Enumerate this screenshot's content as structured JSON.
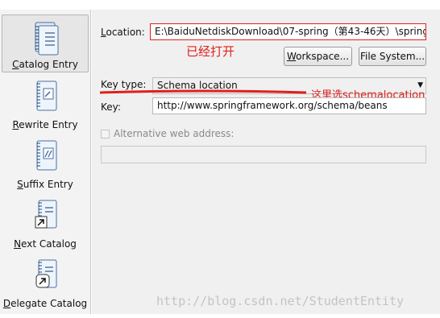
{
  "sidebar": {
    "items": [
      {
        "label": "Catalog Entry",
        "selected": true,
        "icon": "catalog-entry-icon"
      },
      {
        "label": "Rewrite Entry",
        "selected": false,
        "icon": "rewrite-entry-icon"
      },
      {
        "label": "Suffix Entry",
        "selected": false,
        "icon": "suffix-entry-icon"
      },
      {
        "label": "Next Catalog",
        "selected": false,
        "icon": "next-catalog-icon"
      },
      {
        "label": "Delegate Catalog",
        "selected": false,
        "icon": "delegate-catalog-icon"
      }
    ]
  },
  "form": {
    "location_label": "Location:",
    "location_value": "E:\\BaiduNetdiskDownload\\07-spring（第43-46天）\\spring",
    "location_note": "已经打开",
    "workspace_button": "Workspace...",
    "filesystem_button": "File System...",
    "keytype_label": "Key type:",
    "keytype_value": "Schema location",
    "keytype_note": "这里选schemalocation",
    "key_label": "Key:",
    "key_value": "http://www.springframework.org/schema/beans",
    "altweb_label": "Alternative web address:",
    "altweb_checked": false,
    "altweb_value": ""
  },
  "watermark": "http://blog.csdn.net/StudentEntity",
  "colors": {
    "annotation": "#e0201a",
    "panel_bg": "#f0f0f0",
    "sidebar_bg": "#f3f3f3"
  }
}
